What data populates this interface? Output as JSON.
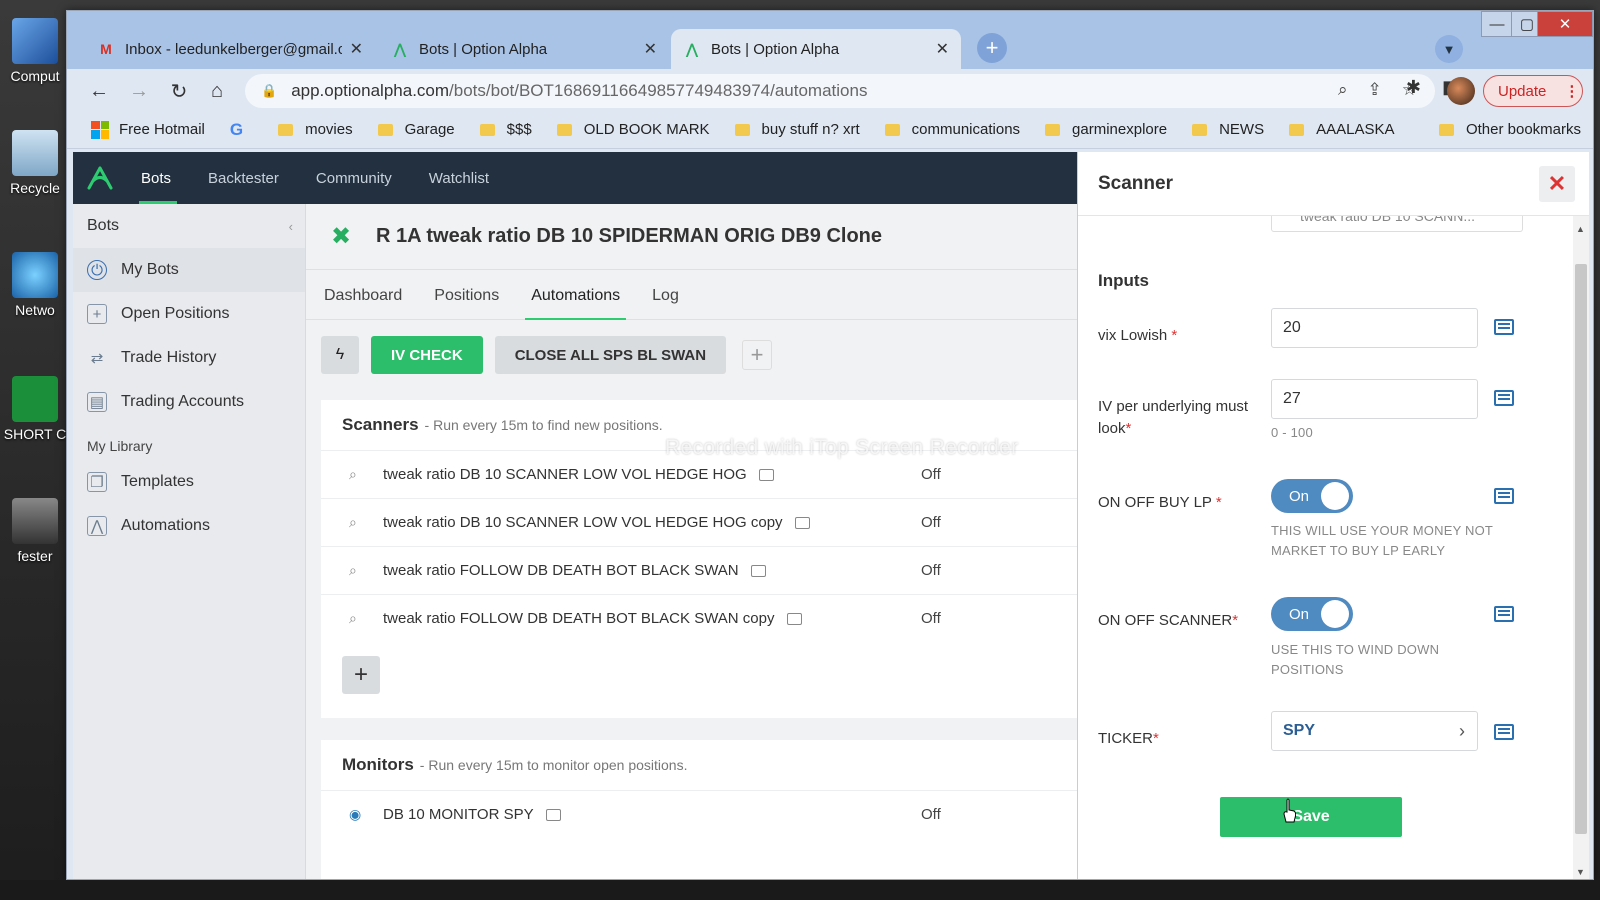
{
  "desktop": {
    "icons": [
      {
        "label": "Comput",
        "name": "computer-icon"
      },
      {
        "label": "Recycle",
        "name": "recycle-bin-icon"
      },
      {
        "label": "Netwo",
        "name": "network-icon"
      },
      {
        "label": "SHORT C",
        "name": "shortcut-icon"
      },
      {
        "label": "fester",
        "name": "user-photo-icon"
      }
    ]
  },
  "browser": {
    "tabs": [
      {
        "title": "Inbox - leedunkelberger@gmail.c",
        "favicon": "M",
        "active": false
      },
      {
        "title": "Bots | Option Alpha",
        "favicon": "option-alpha",
        "active": false
      },
      {
        "title": "Bots | Option Alpha",
        "favicon": "option-alpha",
        "active": true
      }
    ],
    "url_host": "app.optionalpha.com",
    "url_path": "/bots/bot/BOT1686911664985774948397​4/automations",
    "update_label": "Update",
    "bookmarks": [
      {
        "label": "Free Hotmail",
        "type": "ms"
      },
      {
        "label": "",
        "type": "google"
      },
      {
        "label": "movies",
        "type": "folder"
      },
      {
        "label": "Garage",
        "type": "folder"
      },
      {
        "label": "$$$",
        "type": "folder"
      },
      {
        "label": "OLD BOOK MARK",
        "type": "folder"
      },
      {
        "label": "buy stuff n? xrt",
        "type": "folder"
      },
      {
        "label": "communications",
        "type": "folder"
      },
      {
        "label": "garminexplore",
        "type": "folder"
      },
      {
        "label": "NEWS",
        "type": "folder"
      },
      {
        "label": "AAALASKA",
        "type": "folder"
      }
    ],
    "other_bookmarks": "Other bookmarks"
  },
  "app": {
    "nav": [
      "Bots",
      "Backtester",
      "Community",
      "Watchlist"
    ],
    "sidebar": {
      "title": "Bots",
      "items": [
        {
          "label": "My Bots",
          "icon": "power-icon"
        },
        {
          "label": "Open Positions",
          "icon": "plus-square-icon"
        },
        {
          "label": "Trade History",
          "icon": "history-icon"
        },
        {
          "label": "Trading Accounts",
          "icon": "accounts-icon"
        }
      ],
      "library_title": "My Library",
      "library_items": [
        {
          "label": "Templates",
          "icon": "templates-icon"
        },
        {
          "label": "Automations",
          "icon": "automations-icon"
        }
      ]
    },
    "bot_title": "R 1A tweak ratio DB 10 SPIDERMAN ORIG DB9 Clone",
    "subtabs": [
      "Dashboard",
      "Positions",
      "Automations",
      "Log"
    ],
    "actions": {
      "iv_check": "IV CHECK",
      "close_all": "CLOSE ALL SPS BL SWAN"
    },
    "scanners": {
      "title": "Scanners",
      "subtitle": "- Run every 15m to find new positions.",
      "rows": [
        {
          "name": "tweak ratio DB 10 SCANNER LOW VOL HEDGE HOG",
          "status": "Off"
        },
        {
          "name": "tweak ratio DB 10 SCANNER LOW VOL HEDGE HOG copy",
          "status": "Off"
        },
        {
          "name": "tweak ratio FOLLOW DB DEATH BOT BLACK SWAN",
          "status": "Off"
        },
        {
          "name": "tweak ratio FOLLOW DB DEATH BOT BLACK SWAN copy",
          "status": "Off"
        }
      ]
    },
    "monitors": {
      "title": "Monitors",
      "subtitle": "- Run every 15m to monitor open positions.",
      "rows": [
        {
          "name": "DB 10 MONITOR SPY",
          "status": "Off"
        }
      ]
    },
    "watermark": "Recorded with iTop Screen Recorder"
  },
  "panel": {
    "title": "Scanner",
    "clipped_name": "tweak ratio DB 10 SCANN...",
    "inputs_title": "Inputs",
    "fields": {
      "vix_label": "vix Lowish",
      "vix_value": "20",
      "iv_label": "IV per underlying must look",
      "iv_value": "27",
      "iv_hint": "0 - 100",
      "buy_lp_label": "ON OFF BUY LP",
      "buy_lp_toggle": "On",
      "buy_lp_hint": "THIS WILL USE YOUR MONEY NOT MARKET TO BUY LP EARLY",
      "scanner_label": "ON OFF SCANNER",
      "scanner_toggle": "On",
      "scanner_hint": "USE THIS TO WIND DOWN POSITIONS",
      "ticker_label": "TICKER",
      "ticker_value": "SPY"
    },
    "save_label": "Save",
    "required_mark": "*"
  },
  "colors": {
    "accent_green": "#2dbe6c",
    "nav_dark": "#22303f",
    "toggle_blue": "#4f8ac0",
    "required_red": "#d33"
  }
}
